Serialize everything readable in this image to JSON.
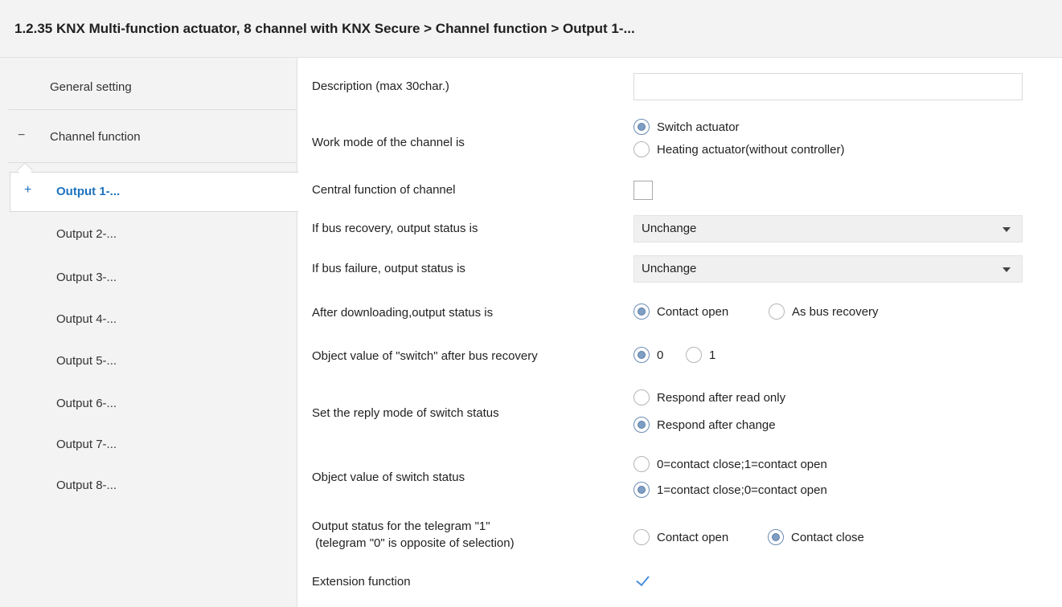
{
  "window": {
    "title": "1.2.35 KNX Multi-function actuator, 8 channel with KNX Secure > Channel function > Output 1-..."
  },
  "sidebar": {
    "items": [
      {
        "label": "General setting"
      },
      {
        "label": "Channel function",
        "expander": "−"
      },
      {
        "label": "Output 1-...",
        "expander": "+",
        "active": true
      },
      {
        "label": "Output 2-..."
      },
      {
        "label": "Output 3-..."
      },
      {
        "label": "Output 4-..."
      },
      {
        "label": "Output 5-..."
      },
      {
        "label": "Output 6-..."
      },
      {
        "label": "Output 7-..."
      },
      {
        "label": "Output 8-..."
      }
    ]
  },
  "params": {
    "description": {
      "label": "Description (max 30char.)",
      "value": ""
    },
    "work_mode": {
      "label": "Work mode of the channel is",
      "options": [
        "Switch actuator",
        "Heating actuator(without controller)"
      ],
      "selected": 0
    },
    "central_function": {
      "label": "Central function of channel",
      "checked": false
    },
    "bus_recovery": {
      "label": "If bus recovery, output status is",
      "value": "Unchange"
    },
    "bus_failure": {
      "label": "If bus failure, output status is",
      "value": "Unchange"
    },
    "after_download": {
      "label": "After downloading,output status is",
      "options": [
        "Contact open",
        "As bus recovery"
      ],
      "selected": 0
    },
    "object_switch": {
      "label": "Object value of \"switch\" after bus recovery",
      "options": [
        "0",
        "1"
      ],
      "selected": 0
    },
    "reply_mode": {
      "label": "Set the reply mode of switch status",
      "options": [
        "Respond after read only",
        "Respond after change"
      ],
      "selected": 1
    },
    "object_value": {
      "label": "Object value of switch status",
      "options": [
        "0=contact close;1=contact open",
        "1=contact close;0=contact open"
      ],
      "selected": 1
    },
    "telegram": {
      "label_line1": "Output status for the telegram \"1\"",
      "label_line2": " (telegram \"0\" is opposite of selection)",
      "options": [
        "Contact open",
        "Contact close"
      ],
      "selected": 1
    },
    "extension": {
      "label": "Extension function",
      "checked": true
    }
  },
  "icons": {
    "selected_radio": "radio-selected-icon",
    "checkmark": "checkmark-icon",
    "dropdown": "chevron-down-icon"
  },
  "colors": {
    "accent": "#1e73be",
    "radio_fill": "#7f9ec4"
  }
}
